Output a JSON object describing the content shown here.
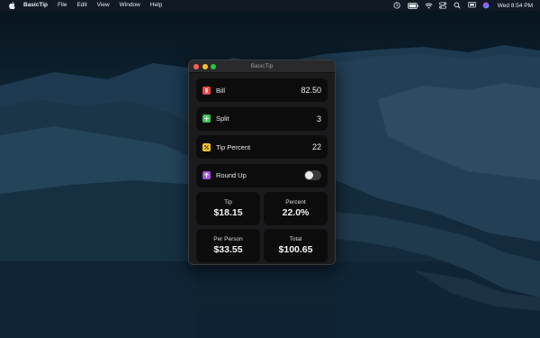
{
  "menubar": {
    "app_name": "BasicTip",
    "menus": [
      "File",
      "Edit",
      "View",
      "Window",
      "Help"
    ],
    "status_icons": [
      "time-machine-icon",
      "battery-icon",
      "wifi-icon",
      "control-center-icon",
      "search-icon",
      "screen-mirroring-icon",
      "siri-icon"
    ],
    "clock": "Wed 8:54 PM"
  },
  "window": {
    "title": "BasicTip"
  },
  "inputs": {
    "bill": {
      "label": "Bill",
      "value": "82.50",
      "icon": "dollar-icon",
      "color": "#e5484d"
    },
    "split": {
      "label": "Split",
      "value": "3",
      "icon": "plus-icon",
      "color": "#3fbf5a"
    },
    "tip_percent": {
      "label": "Tip Percent",
      "value": "22",
      "icon": "percent-icon",
      "color": "#f4c430"
    },
    "round_up": {
      "label": "Round Up",
      "icon": "arrow-up-icon",
      "color": "#a352e0",
      "enabled": false
    }
  },
  "results": {
    "tip": {
      "label": "Tip",
      "value": "$18.15"
    },
    "percent": {
      "label": "Percent",
      "value": "22.0%"
    },
    "per_person": {
      "label": "Per Person",
      "value": "$33.55"
    },
    "total": {
      "label": "Total",
      "value": "$100.65"
    }
  }
}
